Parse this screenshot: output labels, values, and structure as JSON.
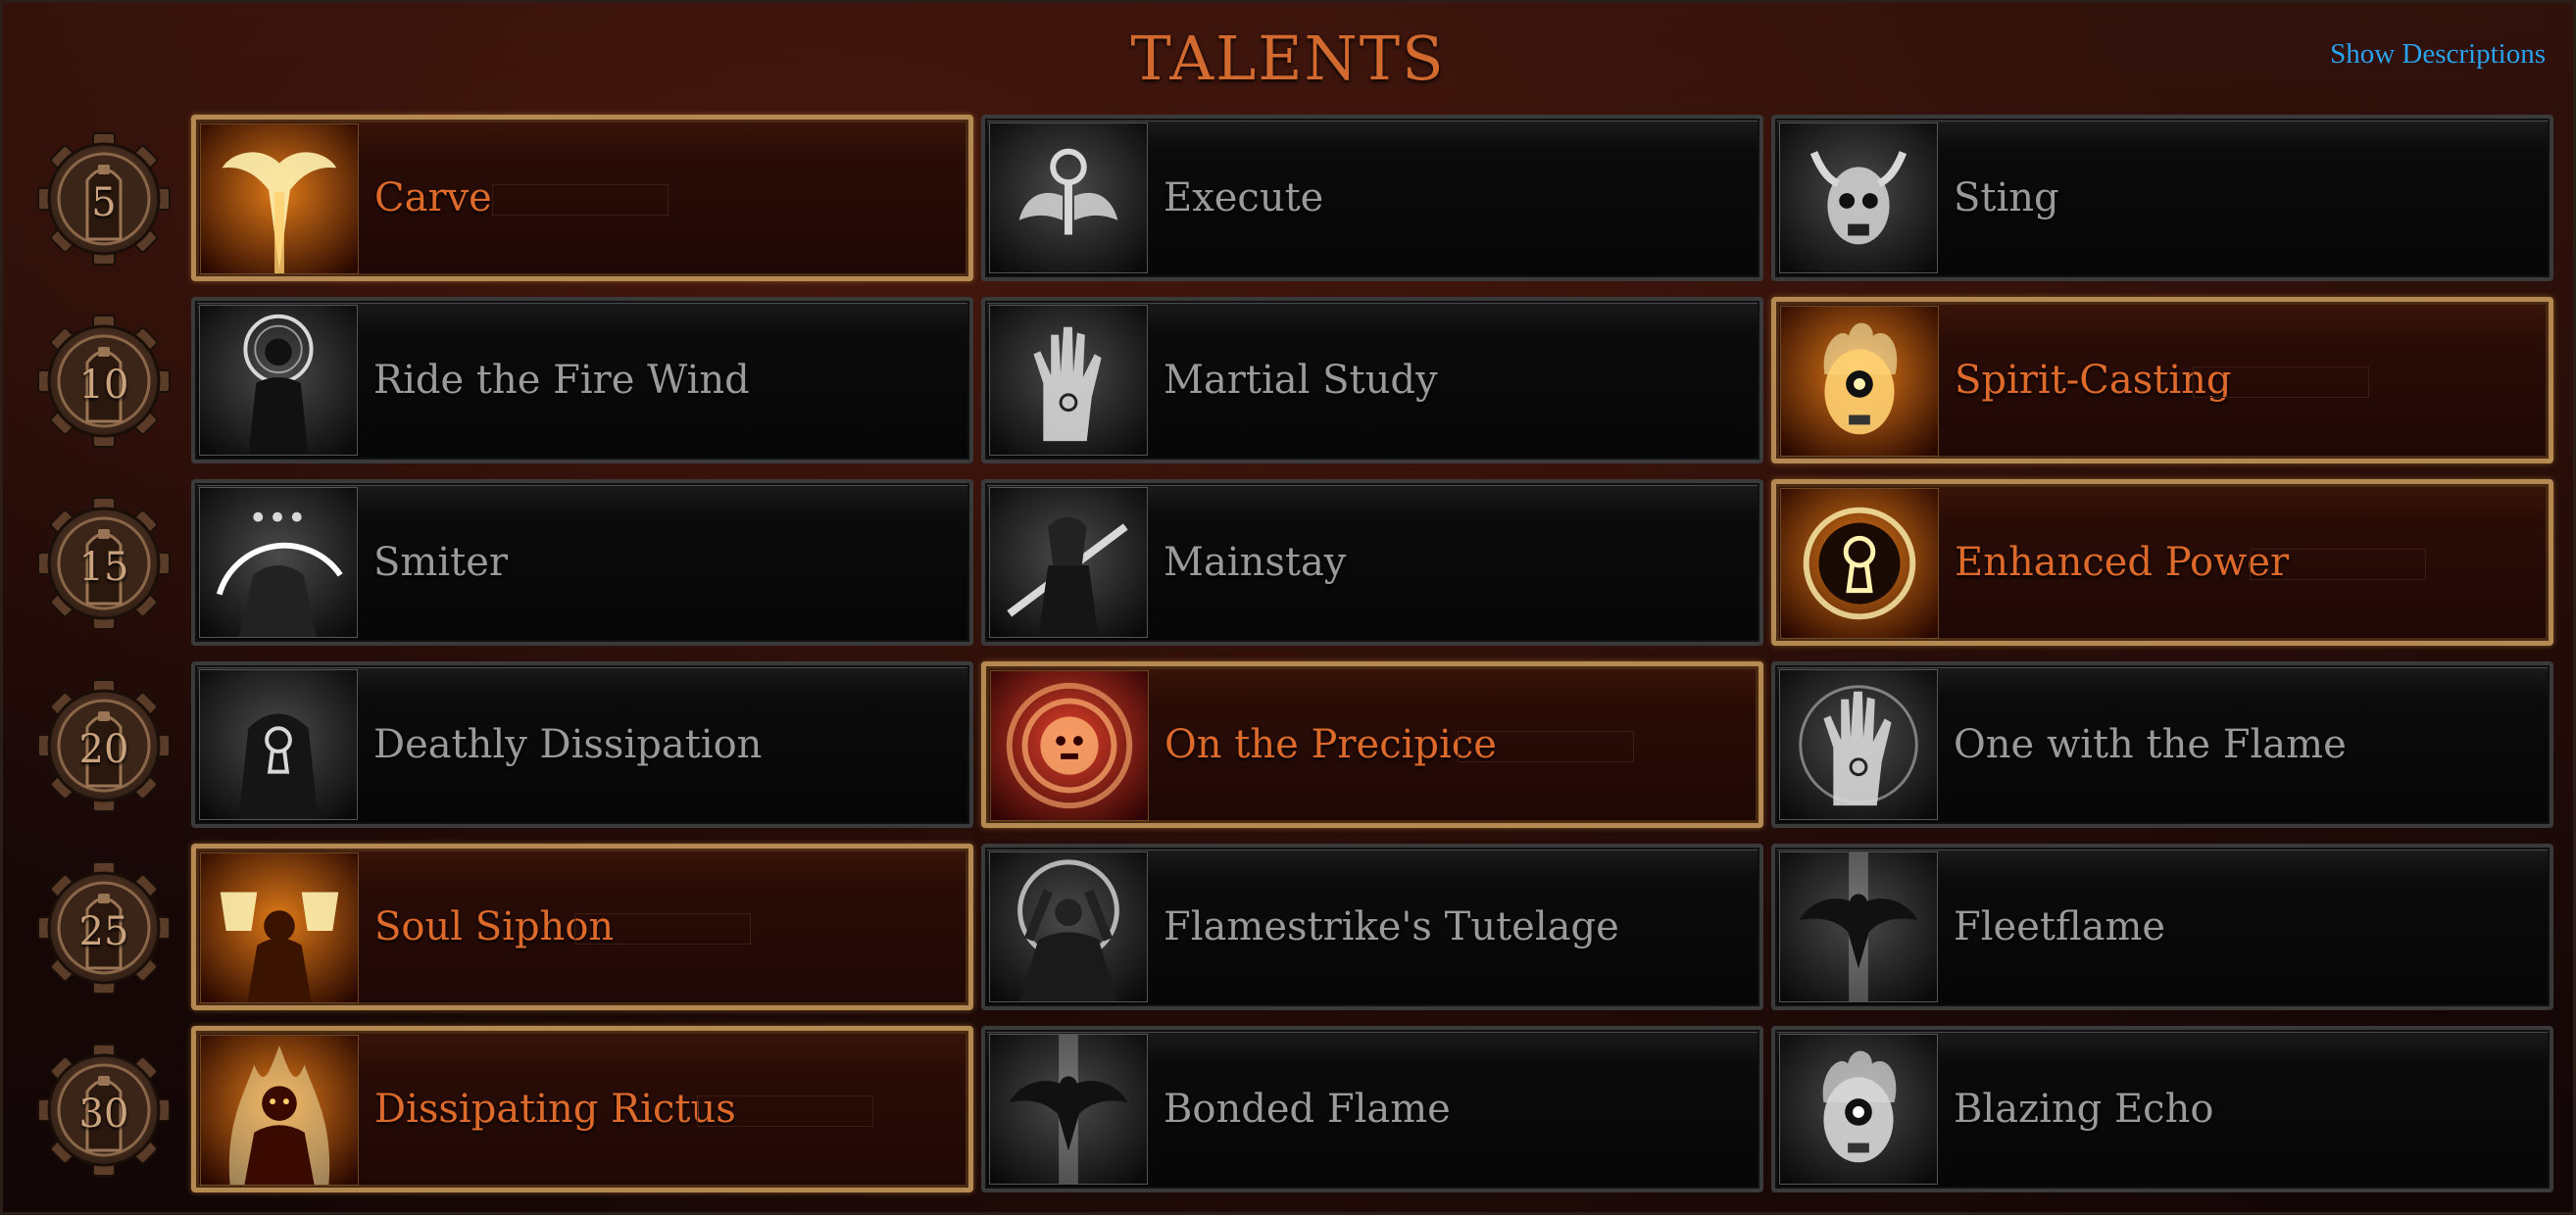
{
  "title": "TALENTS",
  "show_descriptions": "Show Descriptions",
  "rows": [
    {
      "level": "5",
      "talents": [
        {
          "name": "Carve",
          "selected": true,
          "icon": "phoenix-icon",
          "palette": "fire"
        },
        {
          "name": "Execute",
          "selected": false,
          "icon": "winged-ankh-icon",
          "palette": "grey"
        },
        {
          "name": "Sting",
          "selected": false,
          "icon": "horned-skull-icon",
          "palette": "grey"
        }
      ]
    },
    {
      "level": "10",
      "talents": [
        {
          "name": "Ride the Fire Wind",
          "selected": false,
          "icon": "halo-figure-icon",
          "palette": "grey"
        },
        {
          "name": "Martial Study",
          "selected": false,
          "icon": "open-hand-icon",
          "palette": "grey"
        },
        {
          "name": "Spirit-Casting",
          "selected": true,
          "icon": "flaming-skull-icon",
          "palette": "fire"
        }
      ]
    },
    {
      "level": "15",
      "talents": [
        {
          "name": "Smiter",
          "selected": false,
          "icon": "crescent-warrior-icon",
          "palette": "grey"
        },
        {
          "name": "Mainstay",
          "selected": false,
          "icon": "sword-figure-icon",
          "palette": "grey"
        },
        {
          "name": "Enhanced Power",
          "selected": true,
          "icon": "keyhole-sun-icon",
          "palette": "fire"
        }
      ]
    },
    {
      "level": "20",
      "talents": [
        {
          "name": "Deathly Dissipation",
          "selected": false,
          "icon": "keyhole-figure-icon",
          "palette": "grey"
        },
        {
          "name": "On the Precipice",
          "selected": true,
          "icon": "spiral-face-icon",
          "palette": "crimson"
        },
        {
          "name": "One with the Flame",
          "selected": false,
          "icon": "swirl-hand-icon",
          "palette": "grey"
        }
      ]
    },
    {
      "level": "25",
      "talents": [
        {
          "name": "Soul Siphon",
          "selected": true,
          "icon": "chalice-figure-icon",
          "palette": "fire"
        },
        {
          "name": "Flamestrike's Tutelage",
          "selected": false,
          "icon": "orb-figure-icon",
          "palette": "grey"
        },
        {
          "name": "Fleetflame",
          "selected": false,
          "icon": "dove-icon",
          "palette": "grey"
        }
      ]
    },
    {
      "level": "30",
      "talents": [
        {
          "name": "Dissipating Rictus",
          "selected": true,
          "icon": "burning-figure-icon",
          "palette": "fire"
        },
        {
          "name": "Bonded Flame",
          "selected": false,
          "icon": "dove-icon",
          "palette": "grey"
        },
        {
          "name": "Blazing Echo",
          "selected": false,
          "icon": "flaming-skull-icon",
          "palette": "grey"
        }
      ]
    }
  ]
}
